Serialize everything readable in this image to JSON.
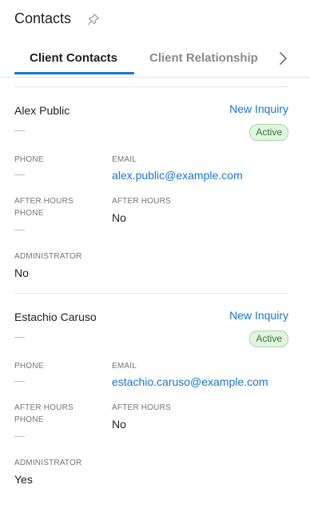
{
  "header": {
    "title": "Contacts",
    "pin_icon": "pin-icon"
  },
  "tabs": [
    {
      "label": "Client Contacts",
      "active": true
    },
    {
      "label": "Client Relationship",
      "active": false
    }
  ],
  "tab_scroll_icon": "chevron-right-icon",
  "colors": {
    "accent": "#1976d2",
    "badge_bg": "#e3f4e1",
    "badge_text": "#2e7d32"
  },
  "contacts": [
    {
      "name": "Alex Public",
      "action": "New Inquiry",
      "subtitle": "—",
      "status": "Active",
      "phone_label": "PHONE",
      "phone_value": "—",
      "email_label": "EMAIL",
      "email_value": "alex.public@example.com",
      "after_hours_phone_label_1": "AFTER HOURS",
      "after_hours_phone_label_2": "PHONE",
      "after_hours_phone_value": "—",
      "after_hours_label": "AFTER HOURS",
      "after_hours_value": "No",
      "administrator_label": "ADMINISTRATOR",
      "administrator_value": "No"
    },
    {
      "name": "Estachio Caruso",
      "action": "New Inquiry",
      "subtitle": "—",
      "status": "Active",
      "phone_label": "PHONE",
      "phone_value": "—",
      "email_label": "EMAIL",
      "email_value": "estachio.caruso@example.com",
      "after_hours_phone_label_1": "AFTER HOURS",
      "after_hours_phone_label_2": "PHONE",
      "after_hours_phone_value": "—",
      "after_hours_label": "AFTER HOURS",
      "after_hours_value": "No",
      "administrator_label": "ADMINISTRATOR",
      "administrator_value": "Yes"
    }
  ]
}
